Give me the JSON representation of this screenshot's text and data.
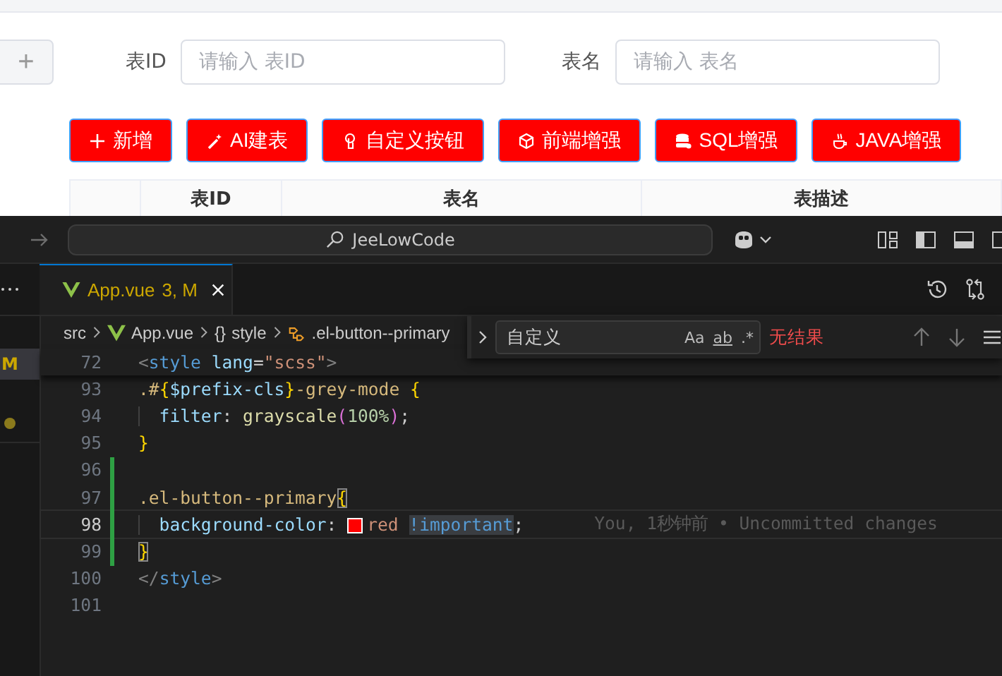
{
  "web_page": {
    "add_tab": "+",
    "filters": [
      {
        "label": "表ID",
        "placeholder": "请输入 表ID"
      },
      {
        "label": "表名",
        "placeholder": "请输入 表名"
      }
    ],
    "toolbar_buttons": [
      {
        "label": "新增"
      },
      {
        "label": "AI建表"
      },
      {
        "label": "自定义按钮"
      },
      {
        "label": "前端增强"
      },
      {
        "label": "SQL增强"
      },
      {
        "label": "JAVA增强"
      }
    ],
    "table": {
      "columns": [
        "表ID",
        "表名",
        "表描述"
      ]
    }
  },
  "editor": {
    "command_center": "JeeLowCode",
    "tabs": [
      {
        "label": "App.vue",
        "badge": "3, M",
        "selected": true
      }
    ],
    "breadcrumbs": [
      {
        "label": "src"
      },
      {
        "label": "App.vue"
      },
      {
        "symbol": "{}",
        "label": "style"
      },
      {
        "label": ".el-button--primary"
      }
    ],
    "sidebar_badge": "M",
    "sticky_line": {
      "number": "72",
      "tokens": [
        {
          "kind": "punct",
          "t": "<"
        },
        {
          "kind": "tag",
          "t": "style"
        },
        {
          "kind": "attr",
          "t": "lang",
          "spaced": true
        },
        {
          "kind": "plain",
          "t": "="
        },
        {
          "kind": "string",
          "t": "\"scss\""
        },
        {
          "kind": "punct",
          "t": ">"
        }
      ]
    },
    "lines": [
      {
        "number": "93",
        "modified": false,
        "current": false,
        "tokens": [
          {
            "kind": "selector",
            "t": ".#"
          },
          {
            "kind": "brace",
            "t": "{"
          },
          {
            "kind": "attr",
            "t": "$prefix-cls"
          },
          {
            "kind": "brace",
            "t": "}"
          },
          {
            "kind": "selector",
            "t": "-grey-mode"
          },
          {
            "kind": "brace",
            "t": "{",
            "spaced": true
          }
        ]
      },
      {
        "number": "94",
        "modified": false,
        "current": false,
        "indented": true,
        "tokens": [
          {
            "kind": "attr",
            "t": "filter"
          },
          {
            "kind": "plain",
            "t": ":"
          },
          {
            "kind": "function",
            "t": "grayscale",
            "spaced": true
          },
          {
            "kind": "paren",
            "t": "("
          },
          {
            "kind": "number",
            "t": "100%"
          },
          {
            "kind": "paren",
            "t": ")"
          },
          {
            "kind": "plain",
            "t": ";"
          }
        ]
      },
      {
        "number": "95",
        "modified": false,
        "current": false,
        "tokens": [
          {
            "kind": "brace",
            "t": "}"
          }
        ]
      },
      {
        "number": "96",
        "modified": true,
        "current": false
      },
      {
        "number": "97",
        "modified": true,
        "current": false,
        "tokens": [
          {
            "kind": "selector",
            "t": ".el-button--primary"
          },
          {
            "kind": "brace_match",
            "t": "{"
          }
        ]
      },
      {
        "number": "98",
        "modified": true,
        "current": true,
        "indented": true,
        "tokens": [
          {
            "kind": "attr",
            "t": "background-color"
          },
          {
            "kind": "plain",
            "t": ":"
          },
          {
            "kind": "swatch",
            "color": "#ff0000",
            "spaced": true
          },
          {
            "kind": "string",
            "t": "red"
          },
          {
            "kind": "important",
            "t": "!important",
            "spaced": true
          },
          {
            "kind": "plain",
            "t": ";"
          }
        ],
        "blame": "You, 1秒钟前 • Uncommitted changes"
      },
      {
        "number": "99",
        "modified": true,
        "current": false,
        "tokens": [
          {
            "kind": "brace_match",
            "t": "}"
          }
        ]
      },
      {
        "number": "100",
        "modified": false,
        "current": false,
        "tokens": [
          {
            "kind": "punct",
            "t": "</"
          },
          {
            "kind": "tag",
            "t": "style"
          },
          {
            "kind": "punct",
            "t": ">"
          }
        ]
      },
      {
        "number": "101",
        "modified": false,
        "current": false
      }
    ],
    "find_widget": {
      "query": "自定义",
      "options": [
        "Aa",
        "ab",
        ".*"
      ],
      "result": "无结果"
    }
  }
}
